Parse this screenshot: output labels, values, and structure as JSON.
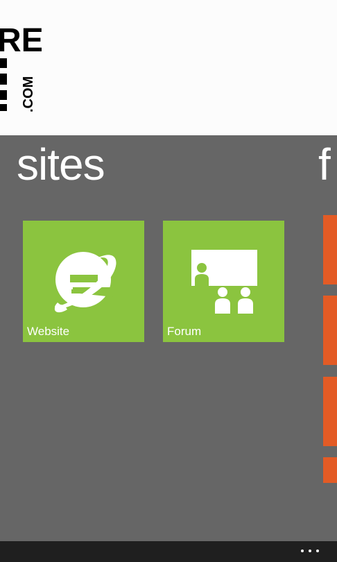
{
  "header": {
    "logo_text_top": "RE",
    "logo_text_side": ".COM"
  },
  "sections": {
    "current": {
      "title": "sites",
      "tiles": [
        {
          "label": "Website",
          "icon": "internet-explorer-icon",
          "color": "#8bc43f"
        },
        {
          "label": "Forum",
          "icon": "presentation-audience-icon",
          "color": "#8bc43f"
        }
      ]
    },
    "next": {
      "title_peek": "f",
      "tile_color": "#e35b25"
    }
  },
  "appbar": {
    "more_icon": "ellipsis-icon"
  },
  "colors": {
    "panorama_background": "#666666",
    "header_background": "#fcfcfc",
    "appbar_background": "#1f1f1f"
  }
}
